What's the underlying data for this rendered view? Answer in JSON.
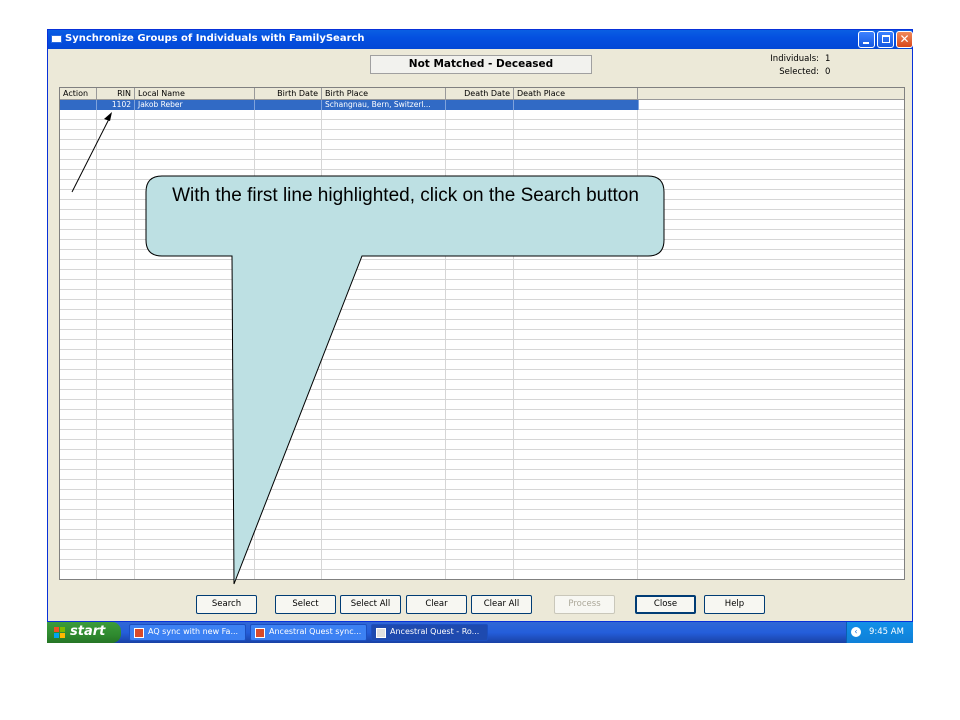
{
  "window": {
    "title": "Synchronize Groups of Individuals with FamilySearch",
    "status": "Not Matched - Deceased",
    "individuals_label": "Individuals:",
    "individuals_value": "1",
    "selected_label": "Selected:",
    "selected_value": "0"
  },
  "grid": {
    "columns": [
      "Action",
      "RIN",
      "Local Name",
      "Birth Date",
      "Birth Place",
      "Death Date",
      "Death Place"
    ],
    "rows": [
      {
        "action": "",
        "rin": "1102",
        "local_name": "Jakob Reber",
        "birth_date": "",
        "birth_place": "Schangnau, Bern, Switzerl...",
        "death_date": "",
        "death_place": ""
      }
    ]
  },
  "buttons": {
    "search": "Search",
    "select": "Select",
    "select_all": "Select All",
    "clear": "Clear",
    "clear_all": "Clear All",
    "process": "Process",
    "close": "Close",
    "help": "Help"
  },
  "taskbar": {
    "start": "start",
    "tasks": [
      "AQ sync with new Fa...",
      "Ancestral Quest sync...",
      "Ancestral Quest - Ro..."
    ],
    "clock": "9:45 AM"
  },
  "callout": {
    "text": "With the first line highlighted, click on the Search button"
  },
  "colors": {
    "titlebar": "#0450e0",
    "selection": "#316ac5",
    "callout_fill": "#bde0e3",
    "taskbar": "#245edb",
    "start": "#2f8a2f"
  }
}
